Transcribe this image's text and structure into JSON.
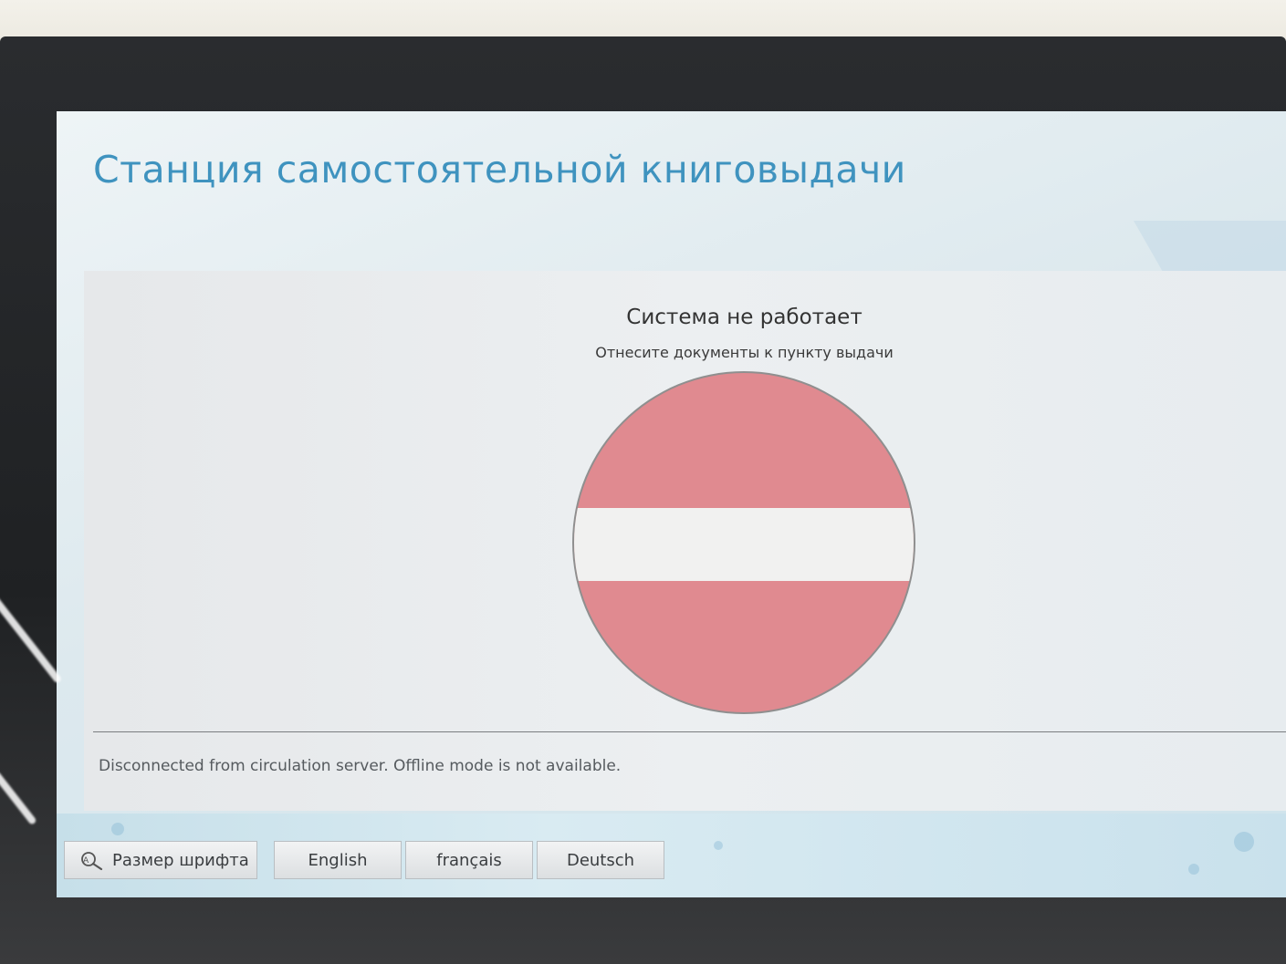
{
  "header": {
    "title": "Станция самостоятельной книговыдачи"
  },
  "status": {
    "title": "Система не работает",
    "subtitle": "Отнесите документы к пункту выдачи",
    "icon": "no-entry-icon"
  },
  "footer": {
    "message": "Disconnected from circulation server. Offline mode is not available."
  },
  "toolbar": {
    "font_size_label": "Размер шрифта",
    "languages": [
      "English",
      "français",
      "Deutsch"
    ]
  },
  "colors": {
    "title": "#3f93bf",
    "no_entry_red": "#e08a90",
    "no_entry_bar": "#f1f1f0"
  }
}
